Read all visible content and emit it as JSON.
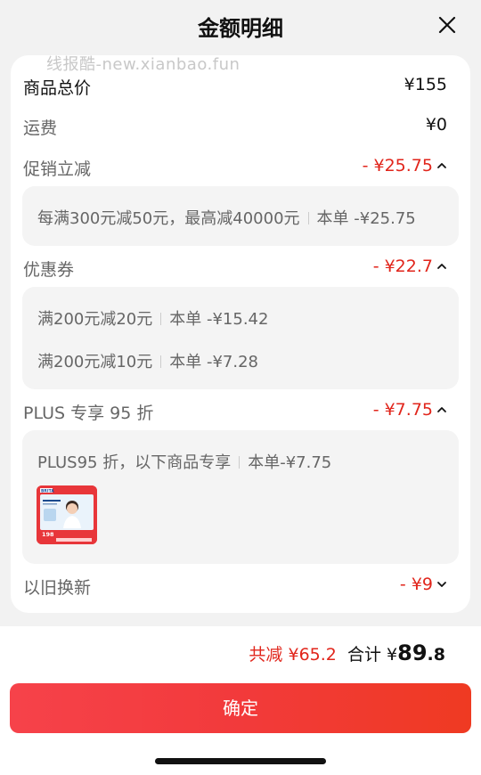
{
  "header": {
    "title": "金额明细"
  },
  "watermark": "线报酷-new.xianbao.fun",
  "rows": {
    "goods_total": {
      "label": "商品总价",
      "value": "¥155"
    },
    "shipping": {
      "label": "运费",
      "value": "¥0"
    },
    "promotion": {
      "label": "促销立减",
      "value": "- ¥25.75"
    },
    "coupon": {
      "label": "优惠券",
      "value": "- ¥22.7"
    },
    "plus": {
      "label": "PLUS 专享 95 折",
      "value": "- ¥7.75"
    },
    "tradein": {
      "label": "以旧换新",
      "value": "- ¥9"
    }
  },
  "promotion_detail": {
    "rule": "每满300元减50元，最高减40000元",
    "amount": "本单 -¥25.75"
  },
  "coupon_detail": [
    {
      "rule": "满200元减20元",
      "amount": "本单 -¥15.42"
    },
    {
      "rule": "满200元减10元",
      "amount": "本单 -¥7.28"
    }
  ],
  "plus_detail": {
    "rule": "PLUS95 折，以下商品专享",
    "amount": "本单-¥7.75"
  },
  "footer": {
    "reduce_label": "共减",
    "reduce_value": "¥65.2",
    "total_label": "合计",
    "total_currency": "¥",
    "total_int": "89",
    "total_dec": ".8"
  },
  "confirm_label": "确定",
  "product_thumb": {
    "brand": "BRITA",
    "price": "198"
  },
  "colors": {
    "accent_red": "#e1251b",
    "button_start": "#f6424a",
    "button_end": "#ef3a22"
  },
  "icons": {
    "close": "close-icon",
    "expanded": "chevron-up-icon",
    "collapsed": "chevron-down-icon"
  }
}
